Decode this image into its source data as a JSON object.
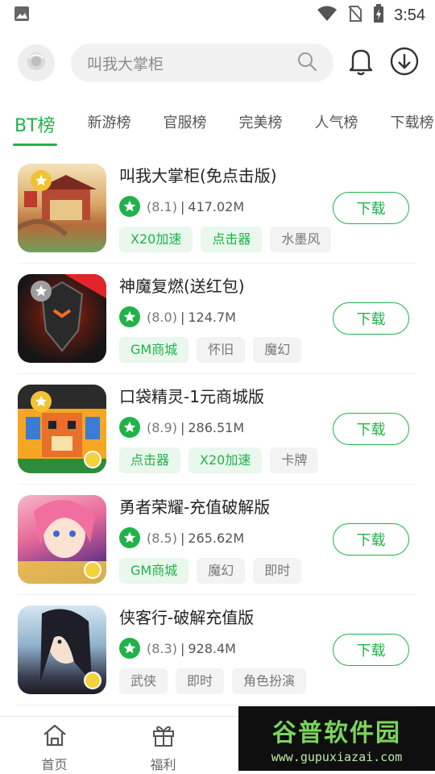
{
  "status_bar": {
    "time": "3:54",
    "icons": [
      "image-icon",
      "wifi-icon",
      "no-sim-icon",
      "battery-charging-icon"
    ]
  },
  "header": {
    "search_placeholder": "叫我大掌柜",
    "icons": [
      "avatar-icon",
      "search-icon",
      "bell-icon",
      "download-icon"
    ]
  },
  "tabs": [
    {
      "label": "BT榜",
      "active": true
    },
    {
      "label": "新游榜",
      "active": false
    },
    {
      "label": "官服榜",
      "active": false
    },
    {
      "label": "完美榜",
      "active": false
    },
    {
      "label": "人气榜",
      "active": false
    },
    {
      "label": "下载榜",
      "active": false
    }
  ],
  "download_label": "下载",
  "games": [
    {
      "name": "叫我大掌柜(免点击版)",
      "score": "(8.1)",
      "size": "417.02M",
      "tags": [
        {
          "text": "X20加速",
          "style": "green"
        },
        {
          "text": "点击器",
          "style": "green"
        },
        {
          "text": "水墨风",
          "style": "gray"
        }
      ]
    },
    {
      "name": "神魔复燃(送红包)",
      "score": "(8.0)",
      "size": "124.7M",
      "tags": [
        {
          "text": "GM商城",
          "style": "green"
        },
        {
          "text": "怀旧",
          "style": "gray"
        },
        {
          "text": "魔幻",
          "style": "gray"
        }
      ]
    },
    {
      "name": "口袋精灵-1元商城版",
      "score": "(8.9)",
      "size": "286.51M",
      "tags": [
        {
          "text": "点击器",
          "style": "green"
        },
        {
          "text": "X20加速",
          "style": "green"
        },
        {
          "text": "卡牌",
          "style": "gray"
        }
      ]
    },
    {
      "name": "勇者荣耀-充值破解版",
      "score": "(8.5)",
      "size": "265.62M",
      "tags": [
        {
          "text": "GM商城",
          "style": "green"
        },
        {
          "text": "魔幻",
          "style": "gray"
        },
        {
          "text": "即时",
          "style": "gray"
        }
      ]
    },
    {
      "name": "侠客行-破解充值版",
      "score": "(8.3)",
      "size": "928.4M",
      "tags": [
        {
          "text": "武侠",
          "style": "gray"
        },
        {
          "text": "即时",
          "style": "gray"
        },
        {
          "text": "角色扮演",
          "style": "gray"
        }
      ]
    }
  ],
  "bottom_nav": [
    {
      "label": "首页",
      "icon": "home-icon"
    },
    {
      "label": "福利",
      "icon": "gift-icon"
    }
  ],
  "watermark": {
    "title": "谷普软件园",
    "url": "www.gupuxiazai.com"
  },
  "colors": {
    "accent": "#21b24a",
    "tag_green_bg": "#e9f7ec",
    "tag_gray_bg": "#f3f3f3"
  }
}
